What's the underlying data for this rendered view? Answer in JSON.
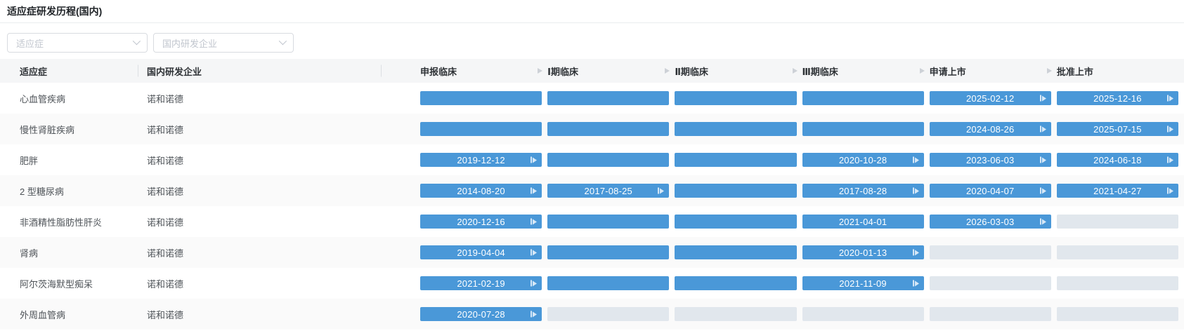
{
  "page": {
    "title": "适应症研发历程(国内)"
  },
  "filters": {
    "indication": {
      "placeholder": "适应症"
    },
    "company": {
      "placeholder": "国内研发企业"
    }
  },
  "table": {
    "headers": {
      "indication": "适应症",
      "company": "国内研发企业"
    },
    "phases": [
      "申报临床",
      "Ⅰ期临床",
      "Ⅱ期临床",
      "Ⅲ期临床",
      "申请上市",
      "批准上市"
    ],
    "rows": [
      {
        "indication": "心血管疾病",
        "company": "诺和诺德",
        "stages": [
          {
            "state": "filled"
          },
          {
            "state": "filled"
          },
          {
            "state": "filled"
          },
          {
            "state": "filled"
          },
          {
            "state": "date",
            "date": "2025-02-12",
            "icon": true
          },
          {
            "state": "date",
            "date": "2025-12-16",
            "icon": true
          }
        ]
      },
      {
        "indication": "慢性肾脏疾病",
        "company": "诺和诺德",
        "stages": [
          {
            "state": "filled"
          },
          {
            "state": "filled"
          },
          {
            "state": "filled"
          },
          {
            "state": "filled"
          },
          {
            "state": "date",
            "date": "2024-08-26",
            "icon": true
          },
          {
            "state": "date",
            "date": "2025-07-15",
            "icon": true
          }
        ]
      },
      {
        "indication": "肥胖",
        "company": "诺和诺德",
        "stages": [
          {
            "state": "date",
            "date": "2019-12-12",
            "icon": true
          },
          {
            "state": "filled"
          },
          {
            "state": "filled"
          },
          {
            "state": "date",
            "date": "2020-10-28",
            "icon": true
          },
          {
            "state": "date",
            "date": "2023-06-03",
            "icon": true
          },
          {
            "state": "date",
            "date": "2024-06-18",
            "icon": true
          }
        ]
      },
      {
        "indication": "2 型糖尿病",
        "company": "诺和诺德",
        "stages": [
          {
            "state": "date",
            "date": "2014-08-20",
            "icon": true
          },
          {
            "state": "date",
            "date": "2017-08-25",
            "icon": true
          },
          {
            "state": "filled"
          },
          {
            "state": "date",
            "date": "2017-08-28",
            "icon": true
          },
          {
            "state": "date",
            "date": "2020-04-07",
            "icon": true
          },
          {
            "state": "date",
            "date": "2021-04-27",
            "icon": true
          }
        ]
      },
      {
        "indication": "非酒精性脂肪性肝炎",
        "company": "诺和诺德",
        "stages": [
          {
            "state": "date",
            "date": "2020-12-16",
            "icon": true
          },
          {
            "state": "filled"
          },
          {
            "state": "filled"
          },
          {
            "state": "date",
            "date": "2021-04-01",
            "icon": false
          },
          {
            "state": "date",
            "date": "2026-03-03",
            "icon": true
          },
          {
            "state": "empty"
          }
        ]
      },
      {
        "indication": "肾病",
        "company": "诺和诺德",
        "stages": [
          {
            "state": "date",
            "date": "2019-04-04",
            "icon": true
          },
          {
            "state": "filled"
          },
          {
            "state": "filled"
          },
          {
            "state": "date",
            "date": "2020-01-13",
            "icon": true
          },
          {
            "state": "empty"
          },
          {
            "state": "empty"
          }
        ]
      },
      {
        "indication": "阿尔茨海默型痴呆",
        "company": "诺和诺德",
        "stages": [
          {
            "state": "date",
            "date": "2021-02-19",
            "icon": true
          },
          {
            "state": "filled"
          },
          {
            "state": "filled"
          },
          {
            "state": "date",
            "date": "2021-11-09",
            "icon": true
          },
          {
            "state": "empty"
          },
          {
            "state": "empty"
          }
        ]
      },
      {
        "indication": "外周血管病",
        "company": "诺和诺德",
        "stages": [
          {
            "state": "date",
            "date": "2020-07-28",
            "icon": true
          },
          {
            "state": "empty"
          },
          {
            "state": "empty"
          },
          {
            "state": "empty"
          },
          {
            "state": "empty"
          },
          {
            "state": "empty"
          }
        ]
      }
    ]
  },
  "colors": {
    "bar_blue": "#4a98d8",
    "bar_empty": "#e1e7ed",
    "header_bg": "#f5f6f7",
    "alt_row_bg": "#fafafa"
  }
}
